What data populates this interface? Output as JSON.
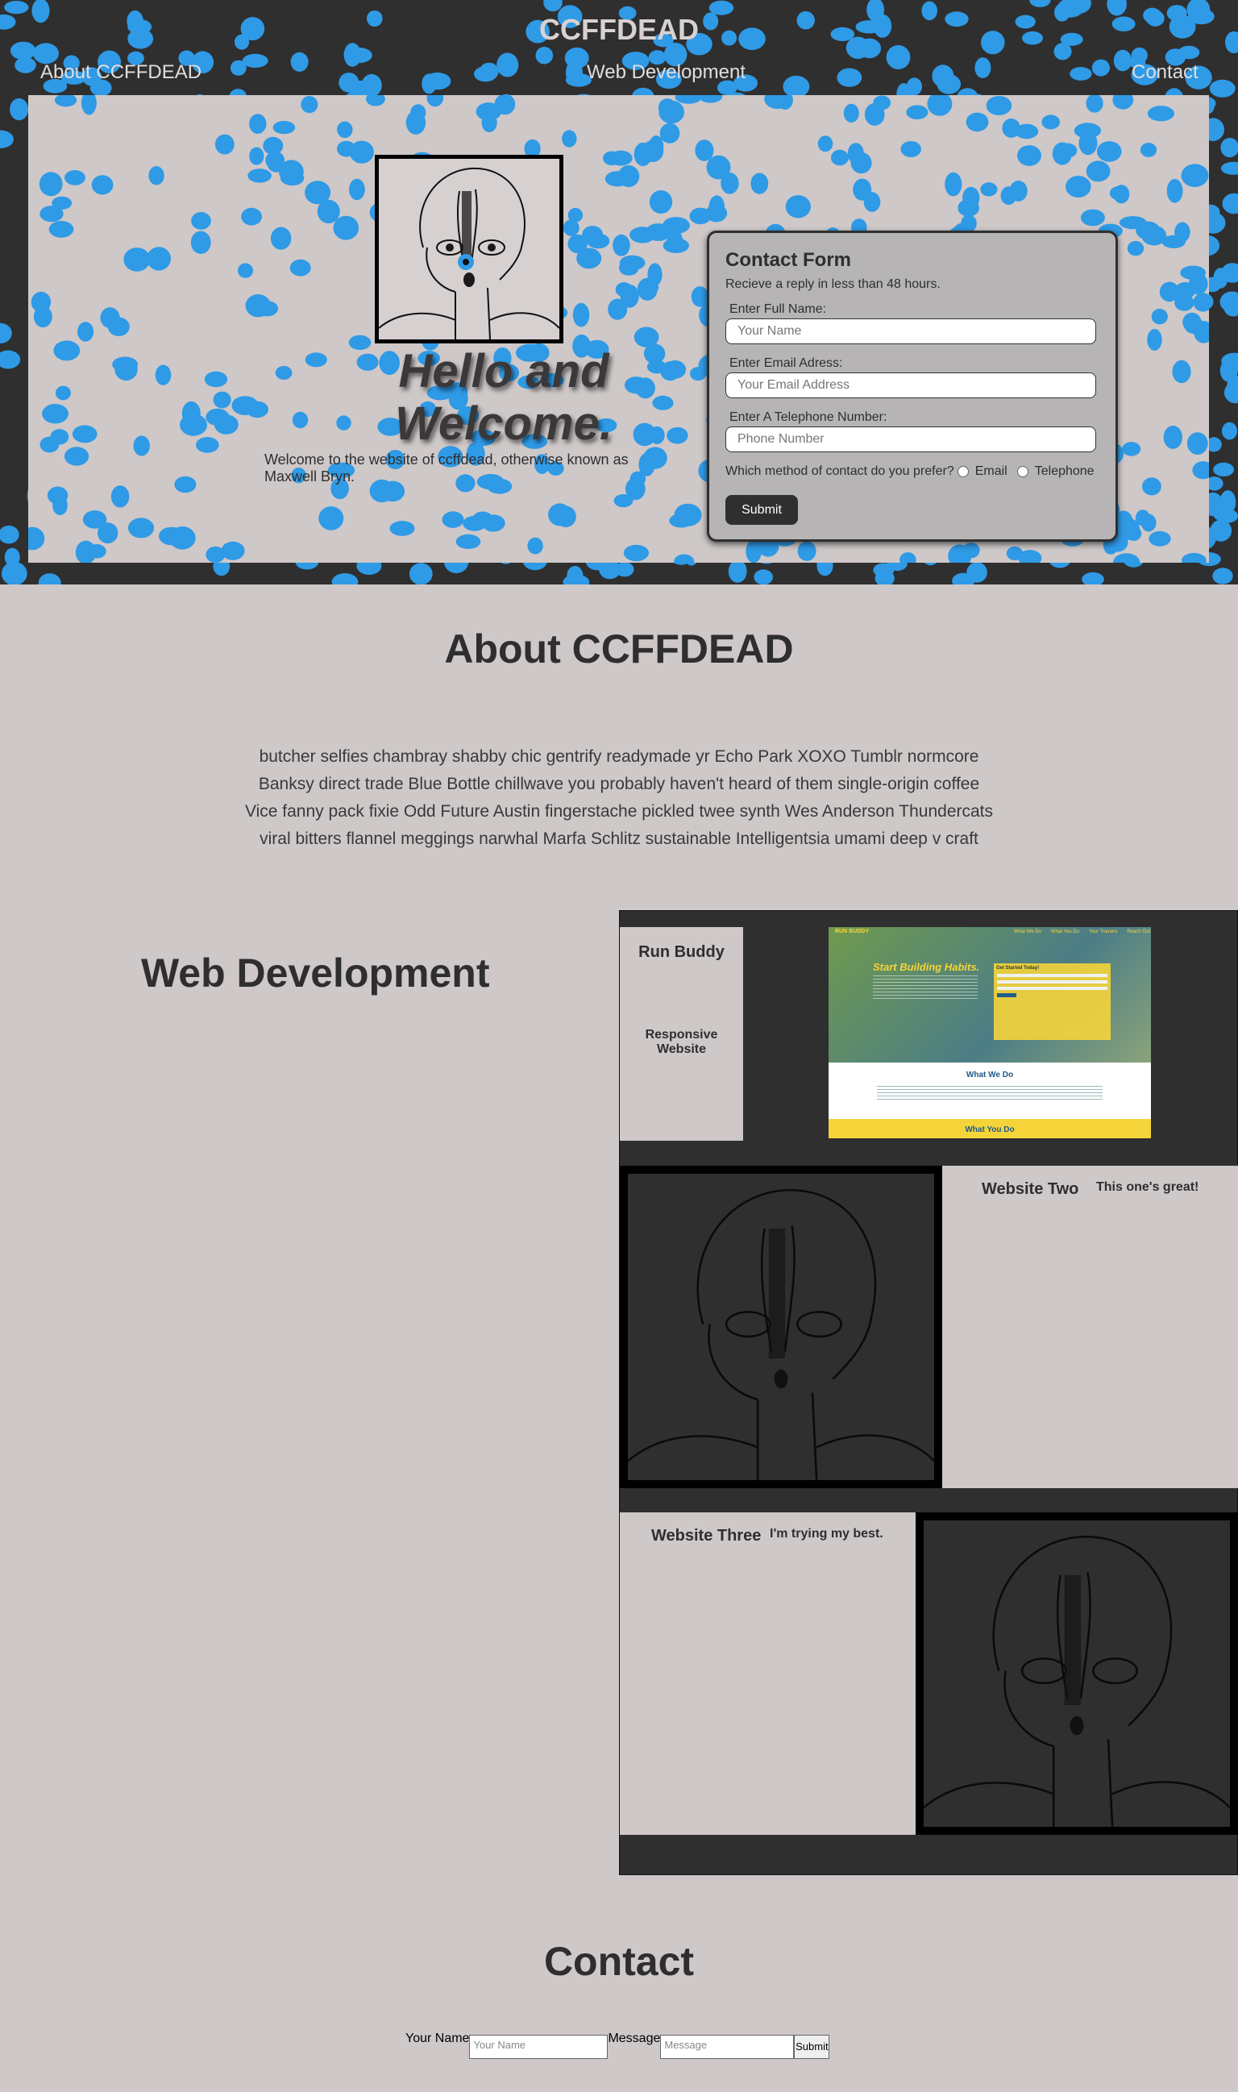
{
  "header": {
    "site_title": "CCFFDEAD",
    "nav": [
      "About CCFFDEAD",
      "Web Development",
      "Contact"
    ]
  },
  "hero": {
    "heading": "Hello and Welcome.",
    "welcome_text": "Welcome to the website of ccffdead, otherwise known as Maxwell Bryn."
  },
  "contact_form": {
    "title": "Contact Form",
    "subtitle": "Recieve a reply in less than 48 hours.",
    "fields": [
      {
        "label": "Enter Full Name:",
        "placeholder": "Your Name"
      },
      {
        "label": "Enter Email Adress:",
        "placeholder": "Your Email Address"
      },
      {
        "label": "Enter A Telephone Number:",
        "placeholder": "Phone Number"
      }
    ],
    "method_question": "Which method of contact do you prefer?",
    "method_options": [
      "Email",
      "Telephone"
    ],
    "submit_label": "Submit"
  },
  "about": {
    "title": "About CCFFDEAD",
    "text": "butcher selfies chambray shabby chic gentrify readymade yr Echo Park XOXO Tumblr normcore Banksy direct trade Blue Bottle chillwave you probably haven't heard of them single-origin coffee Vice fanny pack fixie Odd Future Austin fingerstache pickled twee synth Wes Anderson Thundercats viral bitters flannel meggings narwhal Marfa Schlitz sustainable Intelligentsia umami deep v craft"
  },
  "web_dev": {
    "title": "Web Development",
    "projects": [
      {
        "title": "Run Buddy",
        "subtitle": "Responsive Website"
      },
      {
        "title": "Website Two",
        "subtitle": "This one's great!"
      },
      {
        "title": "Website Three",
        "subtitle": "I'm trying my best."
      }
    ],
    "screenshot": {
      "headline": "Start Building Habits.",
      "form_title": "Get Started Today!",
      "section1": "What We Do",
      "section2": "What You Do",
      "nav": [
        "What We Do",
        "What You Do",
        "Your Trainers",
        "Reach Out"
      ]
    }
  },
  "contact": {
    "title": "Contact",
    "name_label": "Your Name",
    "name_placeholder": "Your Name",
    "message_label": "Message",
    "message_placeholder": "Message",
    "submit_label": "Submit"
  },
  "colors": {
    "dark": "#2f2f2f",
    "background": "#cec8c8",
    "dots": "#2f9ae6",
    "card_gray": "#b6b4b4",
    "runbuddy_yellow": "#f5d43a"
  }
}
